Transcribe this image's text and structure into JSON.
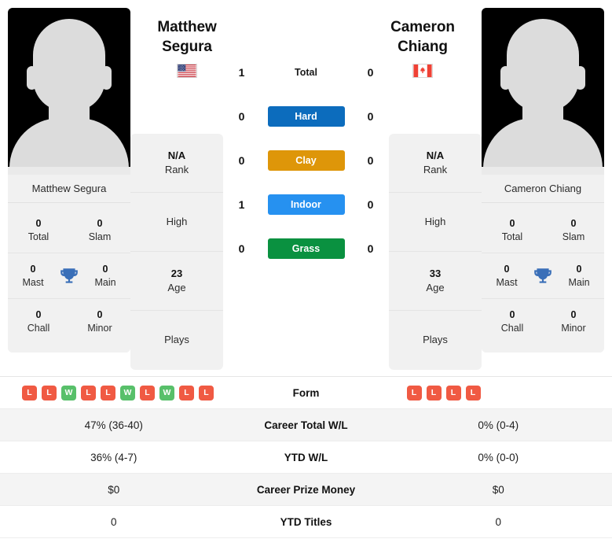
{
  "players": {
    "left": {
      "name": "Matthew Segura",
      "name_line1": "Matthew",
      "name_line2": "Segura",
      "flag": "usa-flag",
      "avatar": "player-avatar-placeholder",
      "titles": {
        "total": "0",
        "total_label": "Total",
        "slam": "0",
        "slam_label": "Slam",
        "mast": "0",
        "mast_label": "Mast",
        "main": "0",
        "main_label": "Main",
        "chall": "0",
        "chall_label": "Chall",
        "minor": "0",
        "minor_label": "Minor"
      },
      "info": {
        "rank": "N/A",
        "rank_label": "Rank",
        "high": "",
        "high_label": "High",
        "age": "23",
        "age_label": "Age",
        "plays": "",
        "plays_label": "Plays"
      },
      "form": [
        "L",
        "L",
        "W",
        "L",
        "L",
        "W",
        "L",
        "W",
        "L",
        "L"
      ],
      "career_total_wl": "47% (36-40)",
      "ytd_wl": "36% (4-7)",
      "career_prize_money": "$0",
      "ytd_titles": "0"
    },
    "right": {
      "name": "Cameron Chiang",
      "name_line1": "Cameron",
      "name_line2": "Chiang",
      "flag": "canada-flag",
      "avatar": "player-avatar-placeholder",
      "titles": {
        "total": "0",
        "total_label": "Total",
        "slam": "0",
        "slam_label": "Slam",
        "mast": "0",
        "mast_label": "Mast",
        "main": "0",
        "main_label": "Main",
        "chall": "0",
        "chall_label": "Chall",
        "minor": "0",
        "minor_label": "Minor"
      },
      "info": {
        "rank": "N/A",
        "rank_label": "Rank",
        "high": "",
        "high_label": "High",
        "age": "33",
        "age_label": "Age",
        "plays": "",
        "plays_label": "Plays"
      },
      "form": [
        "L",
        "L",
        "L",
        "L"
      ],
      "career_total_wl": "0% (0-4)",
      "ytd_wl": "0% (0-0)",
      "career_prize_money": "$0",
      "ytd_titles": "0"
    }
  },
  "head_to_head": [
    {
      "label": "Total",
      "left": "1",
      "right": "0",
      "style": "plain",
      "color": ""
    },
    {
      "label": "Hard",
      "left": "0",
      "right": "0",
      "style": "badge",
      "color": "#0c6cbd"
    },
    {
      "label": "Clay",
      "left": "0",
      "right": "0",
      "style": "badge",
      "color": "#de9609"
    },
    {
      "label": "Indoor",
      "left": "1",
      "right": "0",
      "style": "badge",
      "color": "#2691f0"
    },
    {
      "label": "Grass",
      "left": "0",
      "right": "0",
      "style": "badge",
      "color": "#0a9140"
    }
  ],
  "table": {
    "rows": [
      {
        "label": "Form",
        "type": "form"
      },
      {
        "label": "Career Total W/L",
        "type": "text",
        "key": "career_total_wl"
      },
      {
        "label": "YTD W/L",
        "type": "text",
        "key": "ytd_wl"
      },
      {
        "label": "Career Prize Money",
        "type": "text",
        "key": "career_prize_money"
      },
      {
        "label": "YTD Titles",
        "type": "text",
        "key": "ytd_titles"
      }
    ]
  },
  "colors": {
    "win_chip": "#58c06a",
    "loss_chip": "#f05a43",
    "trophy": "#3a6fb8",
    "panel_bg": "#f1f1f1",
    "row_alt_bg": "#f4f4f4"
  }
}
